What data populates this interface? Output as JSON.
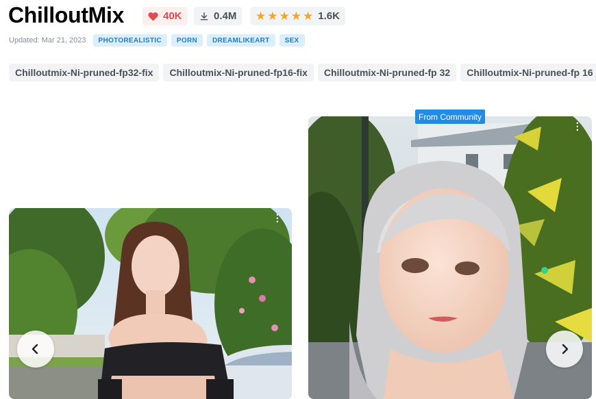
{
  "model": {
    "title": "ChilloutMix",
    "likes": "40K",
    "downloads": "0.4M",
    "rating_count": "1.6K",
    "updated": "Updated: Mar 21, 2023",
    "tags": [
      "PHOTOREALISTIC",
      "PORN",
      "DREAMLIKEART",
      "SEX"
    ]
  },
  "versions": [
    "Chilloutmix-Ni-pruned-fp32-fix",
    "Chilloutmix-Ni-pruned-fp16-fix",
    "Chilloutmix-Ni-pruned-fp 32",
    "Chilloutmix-Ni-pruned-fp 16"
  ],
  "gallery": {
    "community_badge": "From Community",
    "icons": {
      "like": "heart-icon",
      "download": "download-icon",
      "rating": "star-icon",
      "prev": "chevron-left-icon",
      "next": "chevron-right-icon",
      "menu": "more-vertical-icon"
    }
  },
  "colors": {
    "like_red": "#e5484d",
    "star_gold": "#f5a524",
    "tag_bg": "#dbeefc",
    "tag_text": "#1c7ed6",
    "badge_blue": "#228be6"
  }
}
